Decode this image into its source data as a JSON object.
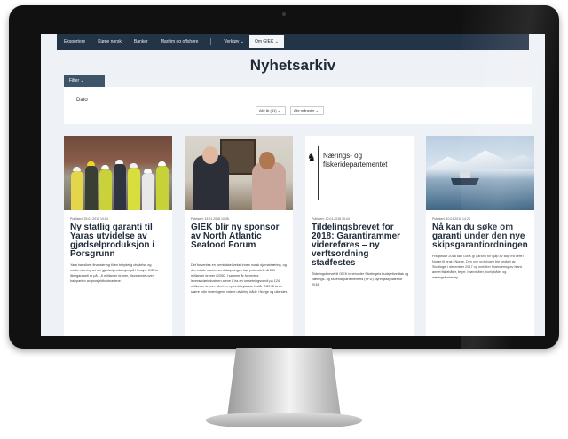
{
  "nav": {
    "items": [
      "Eksportere",
      "Kjøpe norsk",
      "Banker",
      "Maritim og offshore",
      "Verktøy ⌄",
      "Om GIEK ⌄"
    ]
  },
  "page": {
    "title": "Nyhetsarkiv",
    "filter_label": "Filter ⌄",
    "dato_label": "Dato",
    "year_select": "Alle år (81) ⌄",
    "month_select": "Alle måneder ⌄"
  },
  "cards": [
    {
      "meta": "Publisert: 25.01.2018 10:14",
      "title": "Ny statlig garanti til Yaras utvidelse av gjødselproduksjon i Porsgrunn",
      "body": "Yara har sikret finansiering til en betydelig utvidelse og modernisering av sin gjødselproduksjon på Herøya. GIEKs låneganranti er på 1,6 milliarder kroner, tilsvarende over halvparten av prosjektkostnadene."
    },
    {
      "meta": "Publisert: 15.01.2018 10:45",
      "title": "GIEK blir ny sponsor av North Atlantic Seafood Forum",
      "body": "Det forventes en formidabel vekst innen norsk sjømatnæring, og den totale marine verdiskapningen kan potensielt nå 550 milliarder kroner i 2050. I samme år forventes leverandørindustrien alene å ha en omsetningsverdi på 124 milliarder kroner. Med en ny verktøykasse bistår GIEK å ta en større rolle i næringens videre utvikling både i Norge og utlandet."
    },
    {
      "meta": "Publisert: 10.01.2018 15:44",
      "title": "Tildelingsbrevet for 2018: Garantirammer videreføres – ny verftsordning stadfestes",
      "body": "Tildelingsbrevet til GIEK inneholder Stortingets budsjettvedtak og Nærings- og fiskeridepartementets (NFD) styringssignaler for 2018.",
      "logo_text": "Nærings- og fiskeridepartementet"
    },
    {
      "meta": "Publisert: 10.01.2018 14:24",
      "title": "Nå kan du søke om garanti under den nye skipsgarantiordningen",
      "body": "Fra januar 2018 kan GIEK gi garanti for kjøp av skip fra verft i Norge til bruk i Norge. Den nye ordningen ble vedtatt av Stortinget i desember 2017 og omfatter finansiering av blant annet fiskebåter, ferjer, brønnbåter, hurtigbåter og næringslivsfartøy."
    }
  ],
  "colors": {
    "nav_bg": "#243447",
    "filter_bg": "#3e5468",
    "title_color": "#1d2a3a",
    "page_bg": "#eef1f5"
  },
  "icons": {
    "apple": "apple-logo-icon",
    "crest": "lion-crest-icon"
  }
}
